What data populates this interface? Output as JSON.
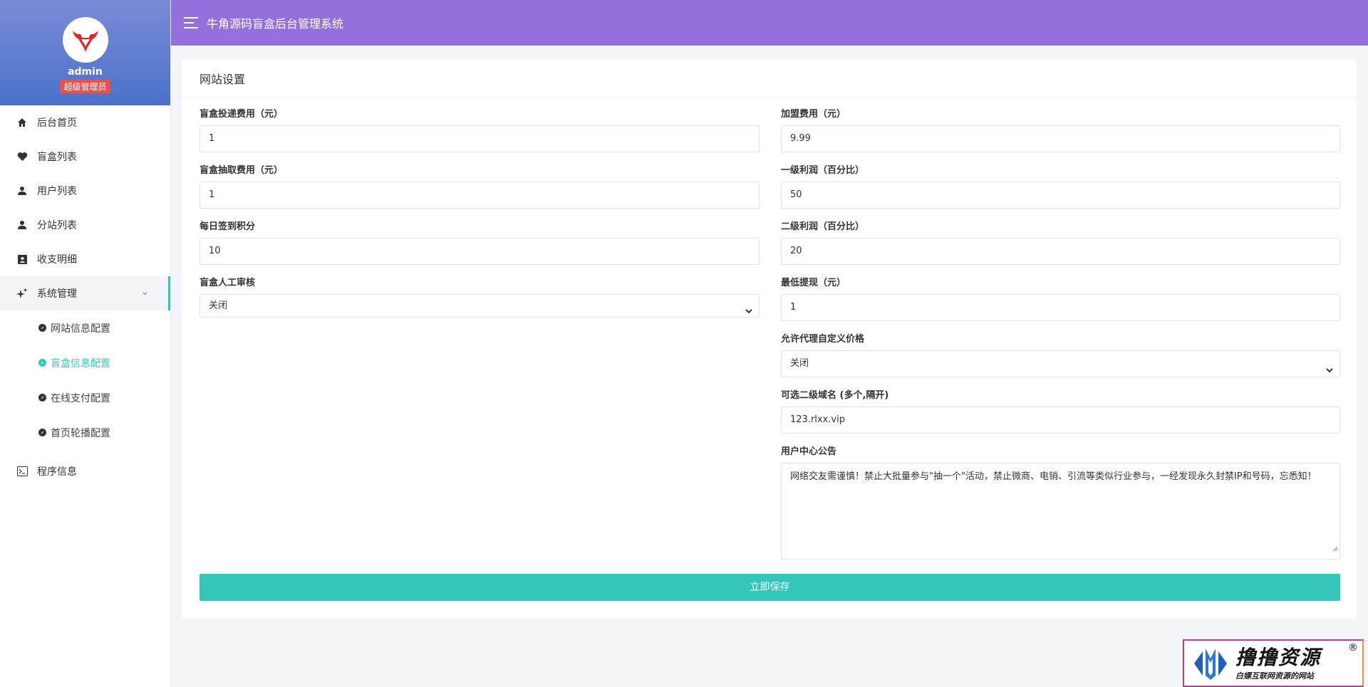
{
  "app": {
    "title": "牛角源码盲盒后台管理系统"
  },
  "profile": {
    "name": "admin",
    "role": "超级管理员"
  },
  "sidebar": {
    "items": [
      {
        "label": "后台首页",
        "icon": "home-icon"
      },
      {
        "label": "盲盒列表",
        "icon": "heart-icon"
      },
      {
        "label": "用户列表",
        "icon": "user-icon"
      },
      {
        "label": "分站列表",
        "icon": "user-icon"
      },
      {
        "label": "收支明细",
        "icon": "contact-card-icon"
      },
      {
        "label": "系统管理",
        "icon": "sparkle-icon"
      }
    ],
    "sub_items": [
      {
        "label": "网站信息配置"
      },
      {
        "label": "盲盒信息配置"
      },
      {
        "label": "在线支付配置"
      },
      {
        "label": "首页轮播配置"
      }
    ],
    "program_info": {
      "label": "程序信息",
      "icon": "terminal-icon"
    }
  },
  "card": {
    "title": "网站设置"
  },
  "form": {
    "left": {
      "delivery_fee": {
        "label": "盲盒投递费用（元）",
        "value": "1"
      },
      "draw_fee": {
        "label": "盲盒抽取费用（元）",
        "value": "1"
      },
      "checkin_points": {
        "label": "每日签到积分",
        "value": "10"
      },
      "manual_review": {
        "label": "盲盒人工审核",
        "value": "关闭"
      }
    },
    "right": {
      "join_fee": {
        "label": "加盟费用（元）",
        "value": "9.99"
      },
      "level1_profit": {
        "label": "一级利润（百分比）",
        "value": "50"
      },
      "level2_profit": {
        "label": "二级利润（百分比）",
        "value": "20"
      },
      "min_withdraw": {
        "label": "最低提现（元）",
        "value": "1"
      },
      "agent_custom_price": {
        "label": "允许代理自定义价格",
        "value": "关闭"
      },
      "subdomains": {
        "label": "可选二级域名 (多个,隔开)",
        "value": "123.rlxx.vip"
      },
      "notice": {
        "label": "用户中心公告",
        "value": "网络交友需谨慎！禁止大批量参与\"抽一个\"活动，禁止微商、电销、引流等类似行业参与，一经发现永久封禁IP和号码，忘悉知！"
      }
    },
    "save_label": "立即保存"
  },
  "watermark": {
    "title": "撸撸资源",
    "subtitle": "白嫖互联网资源的网站",
    "reg": "®"
  },
  "colors": {
    "topbar": "#9370db",
    "accent": "#34c7b9",
    "badge": "#e8514f"
  }
}
